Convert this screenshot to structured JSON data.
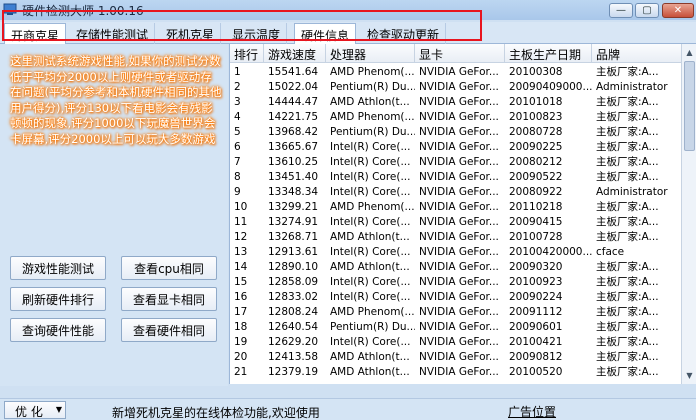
{
  "window": {
    "title": "硬件检测大师 1.00.16",
    "min_label": "—",
    "max_label": "▢",
    "close_label": "✕"
  },
  "tabs": [
    {
      "label": "开商克星"
    },
    {
      "label": "存储性能测试"
    },
    {
      "label": "死机克星"
    },
    {
      "label": "显示温度"
    },
    {
      "label": "硬件信息"
    },
    {
      "label": "检查驱动更新"
    }
  ],
  "left": {
    "info": "这里测试系统游戏性能,如果你的测试分数低于平均分2000以上则硬件或者驱动存在问题(平均分参考和本机硬件相同的其他用户得分),评分130以下看电影会有残影顿顿的现象,评分1000以下玩魔兽世界会卡屏幕,评分2000以上可以玩大多数游戏",
    "buttons": {
      "game_test": "游戏性能测试",
      "view_cpu": "查看cpu相同",
      "refresh_rank": "刷新硬件排行",
      "view_gpu": "查看显卡相同",
      "query_perf": "查询硬件性能",
      "view_hw": "查看硬件相同"
    }
  },
  "table": {
    "columns": [
      "排行",
      "游戏速度",
      "处理器",
      "显卡",
      "主板生产日期",
      "品牌"
    ],
    "rows": [
      [
        "1",
        "15541.64",
        "AMD Phenom(...",
        "NVIDIA GeFor...",
        "20100308",
        "主板厂家:A..."
      ],
      [
        "2",
        "15022.04",
        "Pentium(R) Du...",
        "NVIDIA GeFor...",
        "20090409000...",
        "Administrator"
      ],
      [
        "3",
        "14444.47",
        "AMD Athlon(t...",
        "NVIDIA GeFor...",
        "20101018",
        "主板厂家:A..."
      ],
      [
        "4",
        "14221.75",
        "AMD Phenom(...",
        "NVIDIA GeFor...",
        "20100823",
        "主板厂家:A..."
      ],
      [
        "5",
        "13968.42",
        "Pentium(R) Du...",
        "NVIDIA GeFor...",
        "20080728",
        "主板厂家:A..."
      ],
      [
        "6",
        "13665.67",
        "Intel(R) Core(...",
        "NVIDIA GeFor...",
        "20090225",
        "主板厂家:A..."
      ],
      [
        "7",
        "13610.25",
        "Intel(R) Core(...",
        "NVIDIA GeFor...",
        "20080212",
        "主板厂家:A..."
      ],
      [
        "8",
        "13451.40",
        "Intel(R) Core(...",
        "NVIDIA GeFor...",
        "20090522",
        "主板厂家:A..."
      ],
      [
        "9",
        "13348.34",
        "Intel(R) Core(...",
        "NVIDIA GeFor...",
        "20080922",
        "Administrator"
      ],
      [
        "10",
        "13299.21",
        "AMD Phenom(...",
        "NVIDIA GeFor...",
        "20110218",
        "主板厂家:A..."
      ],
      [
        "11",
        "13274.91",
        "Intel(R) Core(...",
        "NVIDIA GeFor...",
        "20090415",
        "主板厂家:A..."
      ],
      [
        "12",
        "13268.71",
        "AMD Athlon(t...",
        "NVIDIA GeFor...",
        "20100728",
        "主板厂家:A..."
      ],
      [
        "13",
        "12913.61",
        "Intel(R) Core(...",
        "NVIDIA GeFor...",
        "20100420000...",
        "cface"
      ],
      [
        "14",
        "12890.10",
        "AMD Athlon(t...",
        "NVIDIA GeFor...",
        "20090320",
        "主板厂家:A..."
      ],
      [
        "15",
        "12858.09",
        "Intel(R) Core(...",
        "NVIDIA GeFor...",
        "20100923",
        "主板厂家:A..."
      ],
      [
        "16",
        "12833.02",
        "Intel(R) Core(...",
        "NVIDIA GeFor...",
        "20090224",
        "主板厂家:A..."
      ],
      [
        "17",
        "12808.24",
        "AMD Phenom(...",
        "NVIDIA GeFor...",
        "20091112",
        "主板厂家:A..."
      ],
      [
        "18",
        "12640.54",
        "Pentium(R) Du...",
        "NVIDIA GeFor...",
        "20090601",
        "主板厂家:A..."
      ],
      [
        "19",
        "12629.20",
        "Intel(R) Core(...",
        "NVIDIA GeFor...",
        "20100421",
        "主板厂家:A..."
      ],
      [
        "20",
        "12413.58",
        "AMD Athlon(t...",
        "NVIDIA GeFor...",
        "20090812",
        "主板厂家:A..."
      ],
      [
        "21",
        "12379.19",
        "AMD Athlon(t...",
        "NVIDIA GeFor...",
        "20100520",
        "主板厂家:A..."
      ]
    ]
  },
  "status": {
    "optimize_label": "优 化",
    "message": "新增死机克星的在线体检功能,欢迎使用",
    "ad_label": "广告位置"
  },
  "colors": {
    "highlight_box": "#e8141e",
    "info_glow": "#ff7a00",
    "window_bg": "#cfe0f2"
  }
}
